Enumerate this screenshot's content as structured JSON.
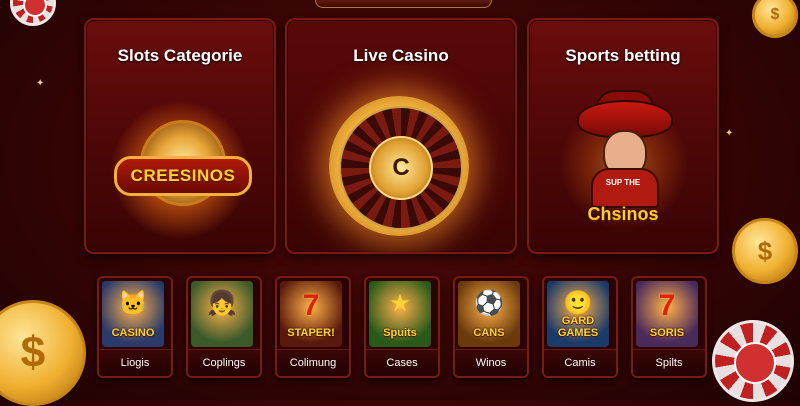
{
  "categories": [
    {
      "title": "Slots Categorie",
      "emblem_text": "CREESINOS"
    },
    {
      "title": "Live Casino",
      "wheel_center": "C"
    },
    {
      "title": "Sports betting",
      "mascot_subtitle": "SUP THE",
      "mascot_text": "Chsinos"
    }
  ],
  "games": [
    {
      "label": "Liogis",
      "art_text": "CASINO",
      "icon": "cat-icon",
      "art_color": "#2a3a6a"
    },
    {
      "label": "Coplings",
      "art_text": "",
      "icon": "girl-icon",
      "art_color": "#3a5a2a"
    },
    {
      "label": "Colimung",
      "art_text": "STAPER!",
      "icon": "seven-icon",
      "art_color": "#5a1a0a"
    },
    {
      "label": "Cases",
      "art_text": "Spuits",
      "icon": "star-icon",
      "art_color": "#2a5a1a"
    },
    {
      "label": "Winos",
      "art_text": "CANS",
      "icon": "soccer-ball-icon",
      "art_color": "#6a3a0a"
    },
    {
      "label": "Camis",
      "art_text": "GARD GAMES",
      "icon": "man-icon",
      "art_color": "#1a3a6a"
    },
    {
      "label": "Spilts",
      "art_text": "SORIS",
      "icon": "seven-icon",
      "art_color": "#4a2a5a"
    }
  ],
  "coins": {
    "symbol": "$"
  },
  "colors": {
    "gold": "#ffd23a",
    "card_border": "#7c1a12",
    "background": "#3a0505"
  }
}
